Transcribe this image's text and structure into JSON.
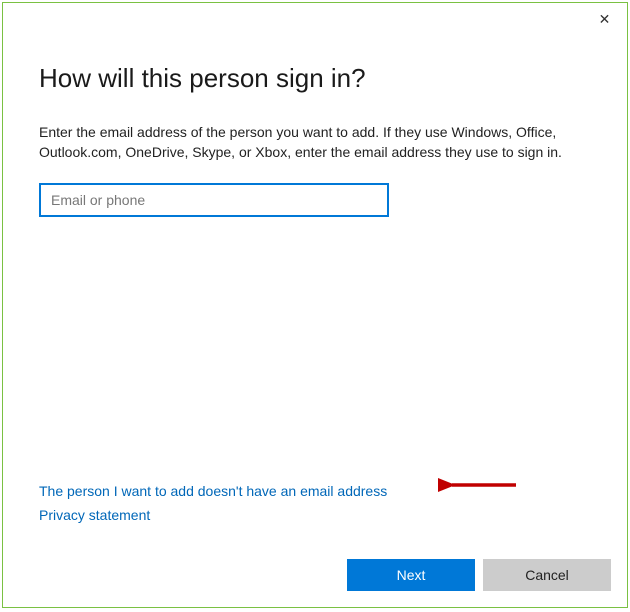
{
  "dialog": {
    "heading": "How will this person sign in?",
    "instructions": "Enter the email address of the person you want to add. If they use Windows, Office, Outlook.com, OneDrive, Skype, or Xbox, enter the email address they use to sign in.",
    "email_input": {
      "placeholder": "Email or phone",
      "value": ""
    },
    "links": {
      "no_email": "The person I want to add doesn't have an email address",
      "privacy": "Privacy statement"
    },
    "buttons": {
      "next": "Next",
      "cancel": "Cancel"
    }
  },
  "annotation": {
    "arrow_color": "#c00000"
  }
}
